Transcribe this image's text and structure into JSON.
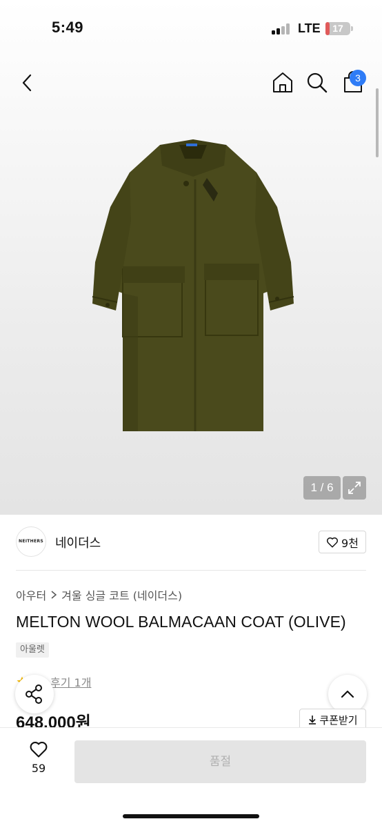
{
  "status_bar": {
    "time": "5:49",
    "network": "LTE",
    "battery_level": "17",
    "battery_fraction": 0.17
  },
  "header": {
    "icons": [
      "back-icon",
      "home-icon",
      "search-icon",
      "shopping-bag-icon"
    ],
    "cart_count": "3"
  },
  "gallery": {
    "counter": "1 / 6",
    "expand_icon": "expand-icon",
    "image_description_colors": {
      "coat": "#4a4a1c",
      "coat_shadow": "#3a3a14",
      "background": "#ececec"
    }
  },
  "brand": {
    "logo_text": "NEITHERS",
    "name": "네이더스",
    "like_count": "9천"
  },
  "product": {
    "breadcrumb": [
      "아우터",
      "겨울 싱글 코트 (네이더스)"
    ],
    "title": "MELTON WOOL BALMACAAN COAT (OLIVE)",
    "tag": "아울렛",
    "review_text": "후기 1개",
    "price": "648,000원",
    "coupon_label": "쿠폰받기"
  },
  "bottom_bar": {
    "wish_count": "59",
    "buy_button_label": "품절"
  },
  "colors": {
    "badge_blue": "#2f7cf6",
    "battery_red": "#e05a5a",
    "star_yellow": "#f5b800"
  }
}
